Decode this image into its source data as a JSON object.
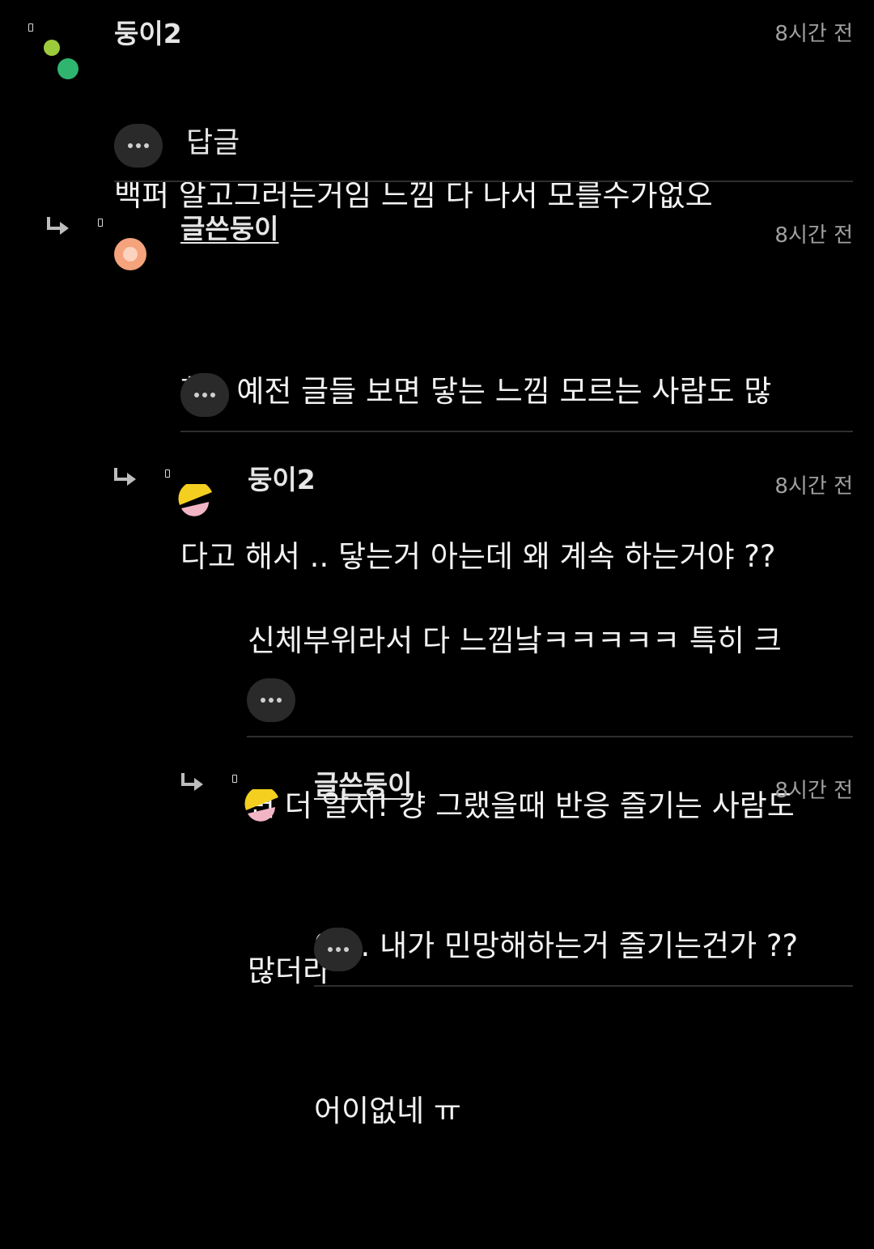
{
  "comments": [
    {
      "nickname": "둥이2",
      "time": "8시간 전",
      "lines": [
        "백퍼 알고그러는거임 느낌 다 나서 모를수가없오"
      ],
      "reply_label": "답글"
    },
    {
      "nickname": "글쓴둥이",
      "time": "8시간 전",
      "lines": [
        "헐 . 예전 글들 보면 닿는 느낌 모르는 사람도 많",
        "다고 해서 .. 닿는거 아는데 왜 계속 하는거야 ??"
      ]
    },
    {
      "nickname": "둥이2",
      "time": "8시간 전",
      "lines": [
        "신체부위라서 다 느낌낰ㅋㅋㅋㅋㅋ 특히 크",
        "면 더 알지! 걍 그랬을때 반응 즐기는 사람도",
        "많더라"
      ]
    },
    {
      "nickname": "글쓴둥이",
      "time": "8시간 전",
      "lines": [
        "아 .. 내가 민망해하는거 즐기는건가 ??",
        "어이없네 ㅠ"
      ]
    }
  ],
  "colors": {
    "background": "#000000",
    "text": "#f2f2f2",
    "time": "#a0a0a0",
    "button_bg": "#2a2a2a",
    "divider": "#2e2e2e",
    "avatar_green_light": "#9ccc3c",
    "avatar_green": "#2fb56f",
    "avatar_orange": "#f4a37c",
    "avatar_yellow": "#f5cf1f",
    "avatar_pink": "#f2b5c5"
  },
  "icons": {
    "pin": "pin-icon",
    "reply_arrow": "reply-arrow-icon",
    "more": "more-icon"
  }
}
